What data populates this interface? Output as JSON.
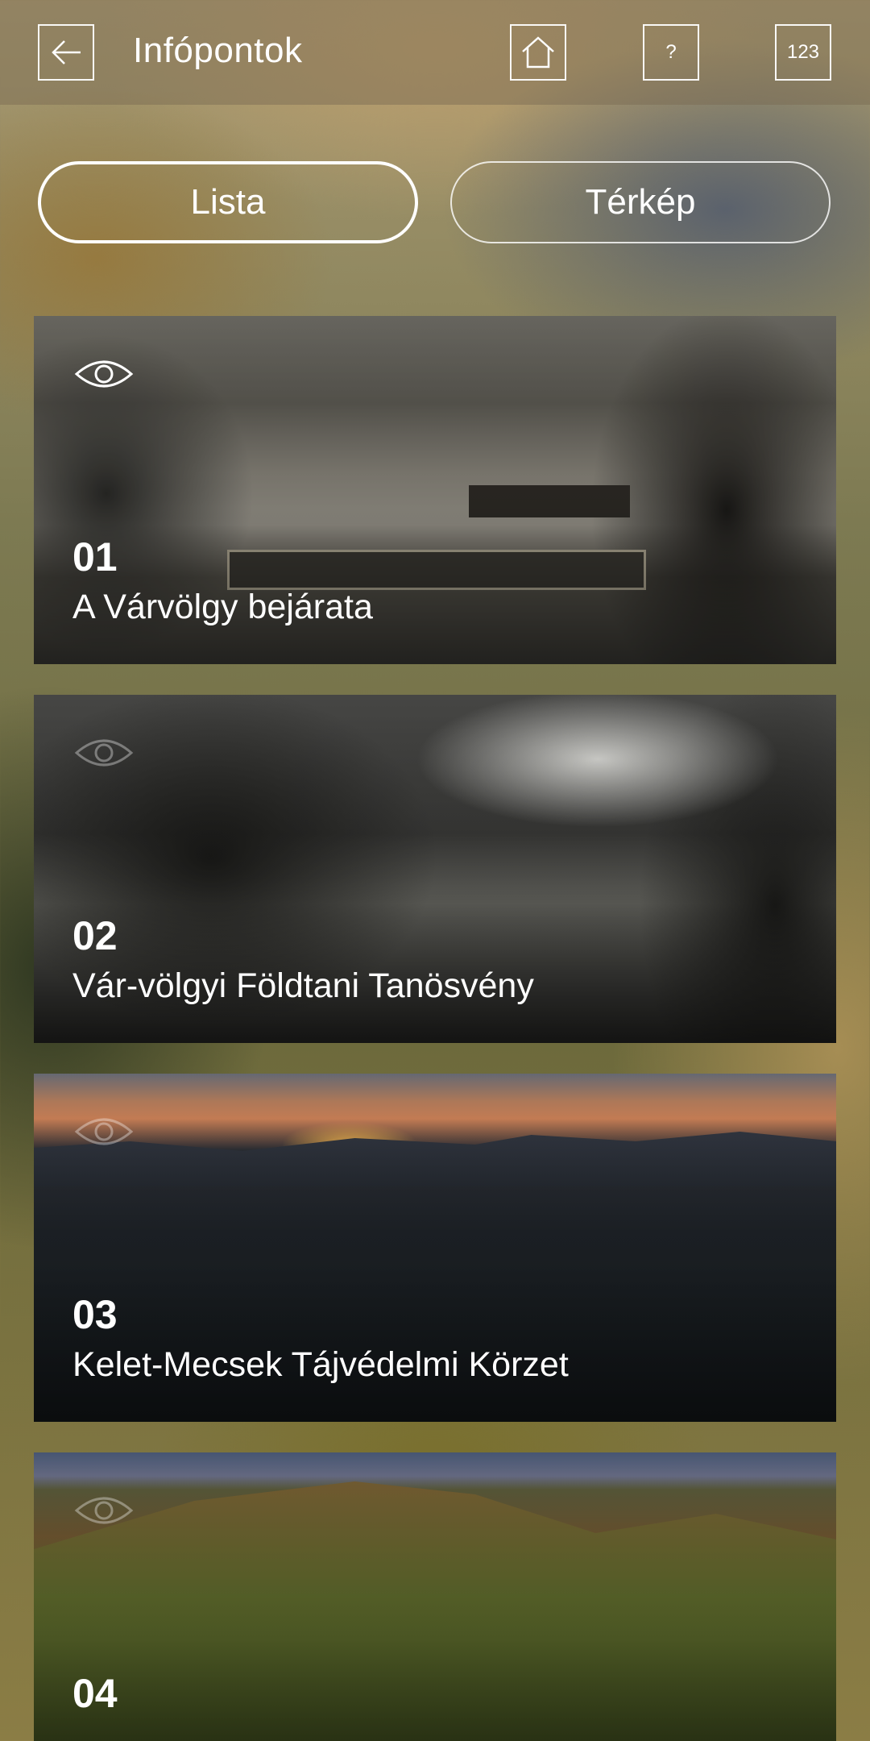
{
  "header": {
    "title": "Infópontok",
    "back_icon": "arrow-left-icon",
    "home_icon": "home-icon",
    "help_label": "?",
    "number_label": "123"
  },
  "tabs": {
    "list_label": "Lista",
    "map_label": "Térkép",
    "selected": "Lista"
  },
  "cards": [
    {
      "number": "01",
      "title": "A Várvölgy bejárata",
      "icon": "eye-icon",
      "viewed": true
    },
    {
      "number": "02",
      "title": "Vár-völgyi Földtani Tanösvény",
      "icon": "eye-icon",
      "viewed": false
    },
    {
      "number": "03",
      "title": "Kelet-Mecsek Tájvédelmi Körzet",
      "icon": "eye-icon",
      "viewed": false
    },
    {
      "number": "04",
      "title": "",
      "icon": "eye-icon",
      "viewed": false
    }
  ]
}
